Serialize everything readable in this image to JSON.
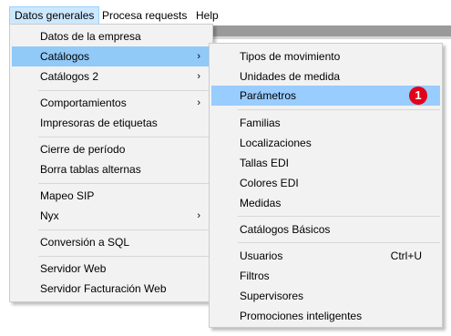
{
  "menubar": {
    "items": [
      "Datos generales",
      "Procesa requests",
      "Help"
    ]
  },
  "main_menu": {
    "items": [
      {
        "label": "Datos de la empresa"
      },
      {
        "label": "Catálogos",
        "arrow": "›"
      },
      {
        "label": "Catálogos 2",
        "arrow": "›"
      },
      {
        "label": "Comportamientos",
        "arrow": "›"
      },
      {
        "label": "Impresoras de etiquetas"
      },
      {
        "label": "Cierre de período"
      },
      {
        "label": "Borra tablas alternas"
      },
      {
        "label": "Mapeo SIP"
      },
      {
        "label": "Nyx",
        "arrow": "›"
      },
      {
        "label": "Conversión a SQL"
      },
      {
        "label": "Servidor Web"
      },
      {
        "label": "Servidor Facturación Web"
      }
    ],
    "selected": "Catálogos"
  },
  "sub_menu": {
    "items": [
      {
        "label": "Tipos de movimiento"
      },
      {
        "label": "Unidades de medida"
      },
      {
        "label": "Parámetros"
      },
      {
        "label": "Familias"
      },
      {
        "label": "Localizaciones"
      },
      {
        "label": "Tallas EDI"
      },
      {
        "label": "Colores EDI"
      },
      {
        "label": "Medidas"
      },
      {
        "label": "Catálogos Básicos"
      },
      {
        "label": "Usuarios",
        "shortcut": "Ctrl+U"
      },
      {
        "label": "Filtros"
      },
      {
        "label": "Supervisores"
      },
      {
        "label": "Promociones inteligentes"
      }
    ],
    "selected": "Parámetros",
    "badge": "1"
  },
  "colors": {
    "menu_bg": "#f2f2f2",
    "highlight": "#91c9f7",
    "menubar_active": "#cce8ff",
    "badge": "#e3001b"
  }
}
